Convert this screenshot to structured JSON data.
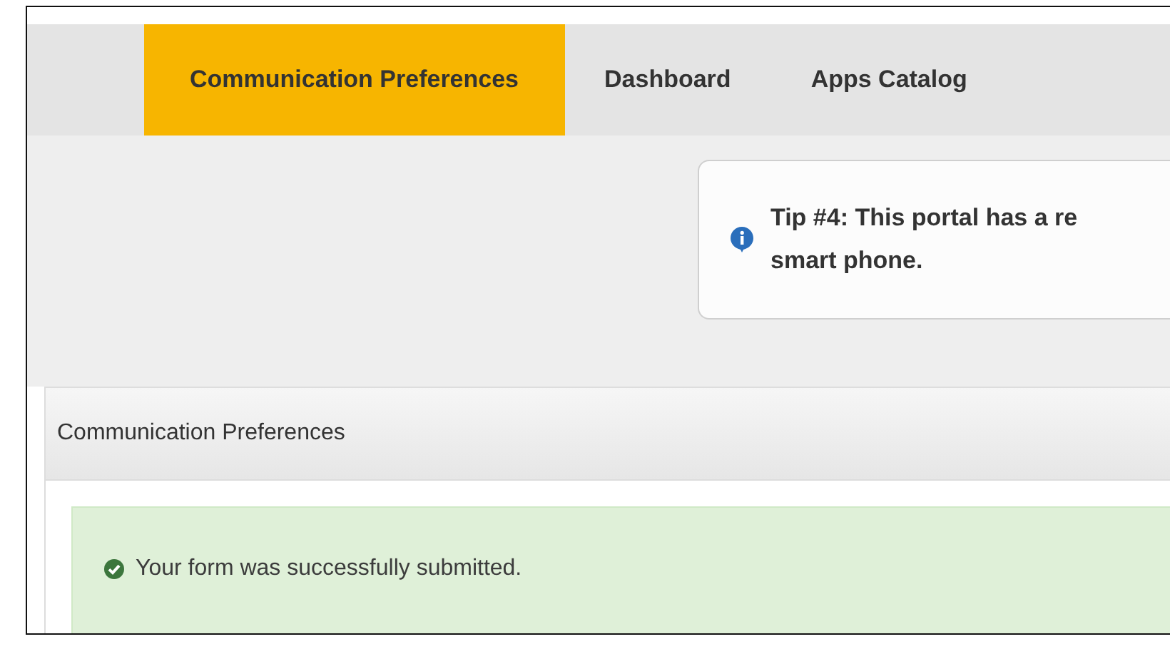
{
  "tabs": [
    {
      "label": "Communication Preferences",
      "selected": true
    },
    {
      "label": "Dashboard",
      "selected": false
    },
    {
      "label": "Apps Catalog",
      "selected": false
    }
  ],
  "tip": {
    "lines": [
      "Tip #4: This portal has a re",
      "smart phone."
    ]
  },
  "panel": {
    "title": "Communication Preferences",
    "alert": "Your form was successfully submitted."
  }
}
